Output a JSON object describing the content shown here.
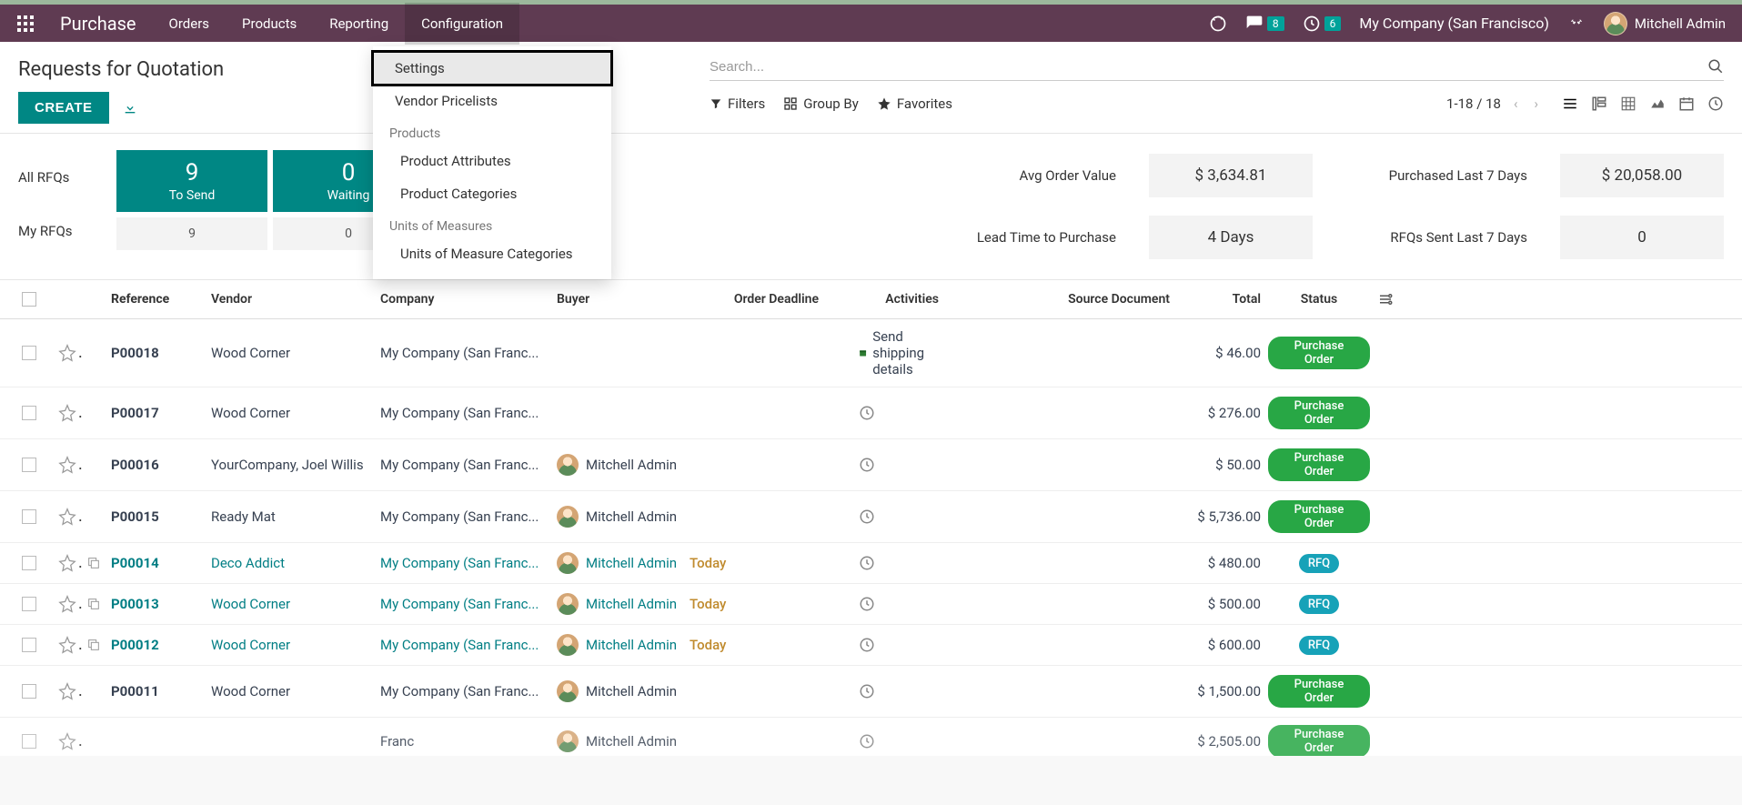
{
  "topbar": {
    "brand": "Purchase",
    "menu": [
      "Orders",
      "Products",
      "Reporting",
      "Configuration"
    ],
    "chat_count": "8",
    "clock_count": "6",
    "company": "My Company (San Francisco)",
    "user": "Mitchell Admin"
  },
  "dropdown": {
    "settings": "Settings",
    "pricelists": "Vendor Pricelists",
    "header_products": "Products",
    "product_attributes": "Product Attributes",
    "product_categories": "Product Categories",
    "header_uom": "Units of Measures",
    "uom_categories": "Units of Measure Categories"
  },
  "page": {
    "title": "Requests for Quotation",
    "create": "CREATE",
    "search_placeholder": "Search...",
    "filters": "Filters",
    "group_by": "Group By",
    "favorites": "Favorites",
    "pager": "1-18 / 18"
  },
  "rfq_labels": {
    "all": "All RFQs",
    "my": "My RFQs"
  },
  "stat_cards": [
    {
      "n": "9",
      "c": "To Send"
    },
    {
      "n": "0",
      "c": "Waiting"
    }
  ],
  "stat_secondary": [
    "9",
    "0"
  ],
  "kpis": [
    {
      "label": "Avg Order Value",
      "value": "$ 3,634.81"
    },
    {
      "label": "Purchased Last 7 Days",
      "value": "$ 20,058.00"
    },
    {
      "label": "Lead Time to Purchase",
      "value": "4 Days"
    },
    {
      "label": "RFQs Sent Last 7 Days",
      "value": "0"
    }
  ],
  "columns": {
    "reference": "Reference",
    "vendor": "Vendor",
    "company": "Company",
    "buyer": "Buyer",
    "deadline": "Order Deadline",
    "activities": "Activities",
    "source": "Source Document",
    "total": "Total",
    "status": "Status"
  },
  "rows": [
    {
      "ref": "P00018",
      "vendor": "Wood Corner",
      "company": "My Company (San Franc...",
      "buyer": "",
      "deadline": "",
      "activity_text": "Send shipping details",
      "activity_green": true,
      "total": "$ 46.00",
      "status": "Purchase Order",
      "status_type": "po",
      "linked": false,
      "copy": false
    },
    {
      "ref": "P00017",
      "vendor": "Wood Corner",
      "company": "My Company (San Franc...",
      "buyer": "",
      "deadline": "",
      "activity_text": "",
      "total": "$ 276.00",
      "status": "Purchase Order",
      "status_type": "po",
      "linked": false,
      "copy": false
    },
    {
      "ref": "P00016",
      "vendor": "YourCompany, Joel Willis",
      "company": "My Company (San Franc...",
      "buyer": "Mitchell Admin",
      "deadline": "",
      "activity_text": "",
      "total": "$ 50.00",
      "status": "Purchase Order",
      "status_type": "po",
      "linked": false,
      "copy": false
    },
    {
      "ref": "P00015",
      "vendor": "Ready Mat",
      "company": "My Company (San Franc...",
      "buyer": "Mitchell Admin",
      "deadline": "",
      "activity_text": "",
      "total": "$ 5,736.00",
      "status": "Purchase Order",
      "status_type": "po",
      "linked": false,
      "copy": false
    },
    {
      "ref": "P00014",
      "vendor": "Deco Addict",
      "company": "My Company (San Franc...",
      "buyer": "Mitchell Admin",
      "deadline": "Today",
      "activity_text": "",
      "total": "$ 480.00",
      "status": "RFQ",
      "status_type": "rfq",
      "linked": true,
      "copy": true
    },
    {
      "ref": "P00013",
      "vendor": "Wood Corner",
      "company": "My Company (San Franc...",
      "buyer": "Mitchell Admin",
      "deadline": "Today",
      "activity_text": "",
      "total": "$ 500.00",
      "status": "RFQ",
      "status_type": "rfq",
      "linked": true,
      "copy": true
    },
    {
      "ref": "P00012",
      "vendor": "Wood Corner",
      "company": "My Company (San Franc...",
      "buyer": "Mitchell Admin",
      "deadline": "Today",
      "activity_text": "",
      "total": "$ 600.00",
      "status": "RFQ",
      "status_type": "rfq",
      "linked": true,
      "copy": true
    },
    {
      "ref": "P00011",
      "vendor": "Wood Corner",
      "company": "My Company (San Franc...",
      "buyer": "Mitchell Admin",
      "deadline": "",
      "activity_text": "",
      "total": "$ 1,500.00",
      "status": "Purchase Order",
      "status_type": "po",
      "linked": false,
      "copy": false
    },
    {
      "ref": "",
      "vendor": "",
      "company": "Franc",
      "buyer": "Mitchell Admin",
      "deadline": "",
      "activity_text": "",
      "total": "$ 2,505.00",
      "status": "Purchase Order",
      "status_type": "po",
      "linked": false,
      "copy": false,
      "partial": true
    }
  ]
}
